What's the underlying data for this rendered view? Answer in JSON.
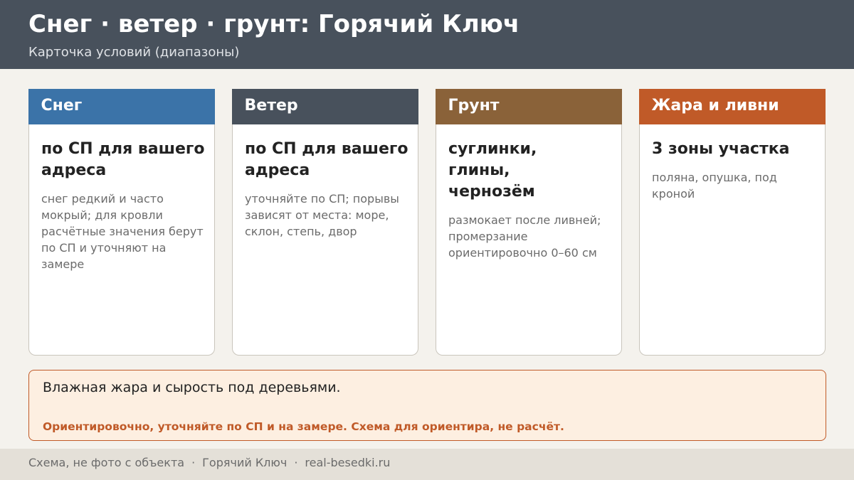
{
  "header": {
    "title": "Снег · ветер · грунт: Горячий Ключ",
    "subtitle": "Карточка условий (диапазоны)"
  },
  "cards": [
    {
      "label": "Снег",
      "color": "#3b73a8",
      "value": "по СП для вашего адреса",
      "note": "снег редкий и часто мокрый; для кровли расчётные значения берут по СП и уточняют на замере"
    },
    {
      "label": "Ветер",
      "color": "#48515c",
      "value": "по СП для вашего адреса",
      "note": "уточняйте по СП; порывы зависят от места: море, склон, степь, двор"
    },
    {
      "label": "Грунт",
      "color": "#8a6239",
      "value": "суглинки, глины, чернозём",
      "note": "размокает после ливней; промерзание ориентировочно 0–60 см"
    },
    {
      "label": "Жара и ливни",
      "color": "#c05a28",
      "value": "3 зоны участка",
      "note": "поляна, опушка, под кроной"
    }
  ],
  "banner": {
    "text": "Влажная жара и сырость под деревьями.",
    "warning": "Ориентировочно, уточняйте по СП и на замере. Схема для ориентира, не расчёт."
  },
  "footer": {
    "items": [
      "Схема, не фото с объекта",
      "Горячий Ключ",
      "real-besedki.ru"
    ],
    "separator": "·"
  }
}
